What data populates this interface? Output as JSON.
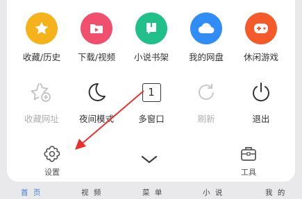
{
  "row1": [
    {
      "label": "收藏/历史",
      "icon": "star-icon",
      "color": "#f5b21a"
    },
    {
      "label": "下载/视频",
      "icon": "video-folder-icon",
      "color": "#f0506e"
    },
    {
      "label": "小说书架",
      "icon": "book-icon",
      "color": "#21c08b"
    },
    {
      "label": "我的网盘",
      "icon": "cloud-icon",
      "color": "#2f8df5"
    },
    {
      "label": "休闲游戏",
      "icon": "gamepad-icon",
      "color": "#f45a2a"
    }
  ],
  "row2": [
    {
      "label": "收藏网址",
      "icon": "star-add-icon",
      "dim": true
    },
    {
      "label": "夜间模式",
      "icon": "moon-icon",
      "dim": false
    },
    {
      "label": "多窗口",
      "icon": "window-count-icon",
      "dim": false,
      "count": "1"
    },
    {
      "label": "刷新",
      "icon": "refresh-icon",
      "dim": true
    },
    {
      "label": "退出",
      "icon": "power-icon",
      "dim": false
    }
  ],
  "bottom": {
    "settings": "设置",
    "tools": "工具"
  },
  "nav": [
    "首 页",
    "视 频",
    "菜 单",
    "小 说",
    "我 的"
  ]
}
